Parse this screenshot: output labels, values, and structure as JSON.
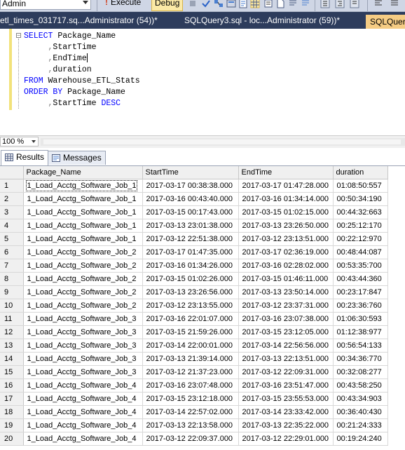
{
  "toolbar": {
    "database": "Admin",
    "execute_label": "Execute",
    "debug_label": "Debug"
  },
  "tabs": [
    {
      "label": "etl_times_031717.sq...Administrator (54))*"
    },
    {
      "label": "SQLQuery3.sql - loc...Administrator (59))*"
    },
    {
      "label": "SQLQuer"
    }
  ],
  "editor": {
    "lines": [
      [
        {
          "t": "SELECT",
          "c": "kw"
        },
        {
          "t": " Package_Name",
          "c": ""
        }
      ],
      [
        {
          "t": "     ",
          "c": ""
        },
        {
          "t": ",",
          "c": "op"
        },
        {
          "t": "StartTime",
          "c": ""
        }
      ],
      [
        {
          "t": "     ",
          "c": ""
        },
        {
          "t": ",",
          "c": "op"
        },
        {
          "t": "EndTime",
          "c": ""
        },
        {
          "t": "|",
          "c": "caret"
        }
      ],
      [
        {
          "t": "     ",
          "c": ""
        },
        {
          "t": ",",
          "c": "op"
        },
        {
          "t": "duration",
          "c": ""
        }
      ],
      [
        {
          "t": "FROM",
          "c": "kw"
        },
        {
          "t": " Warehouse_ETL_Stats",
          "c": ""
        }
      ],
      [
        {
          "t": "ORDER BY",
          "c": "kw"
        },
        {
          "t": " Package_Name",
          "c": ""
        }
      ],
      [
        {
          "t": "     ",
          "c": ""
        },
        {
          "t": ",",
          "c": "op"
        },
        {
          "t": "StartTime ",
          "c": ""
        },
        {
          "t": "DESC",
          "c": "kw"
        }
      ]
    ]
  },
  "zoom": {
    "value": "100 %"
  },
  "results_tabs": [
    {
      "label": "Results",
      "icon": "grid-icon"
    },
    {
      "label": "Messages",
      "icon": "messages-icon"
    }
  ],
  "grid": {
    "columns": [
      "Package_Name",
      "StartTime",
      "EndTime",
      "duration"
    ],
    "rows": [
      [
        "1",
        "1_Load_Acctg_Software_Job_1",
        "2017-03-17 00:38:38.000",
        "2017-03-17 01:47:28.000",
        "01:08:50:557"
      ],
      [
        "2",
        "1_Load_Acctg_Software_Job_1",
        "2017-03-16 00:43:40.000",
        "2017-03-16 01:34:14.000",
        "00:50:34:190"
      ],
      [
        "3",
        "1_Load_Acctg_Software_Job_1",
        "2017-03-15 00:17:43.000",
        "2017-03-15 01:02:15.000",
        "00:44:32:663"
      ],
      [
        "4",
        "1_Load_Acctg_Software_Job_1",
        "2017-03-13 23:01:38.000",
        "2017-03-13 23:26:50.000",
        "00:25:12:170"
      ],
      [
        "5",
        "1_Load_Acctg_Software_Job_1",
        "2017-03-12 22:51:38.000",
        "2017-03-12 23:13:51.000",
        "00:22:12:970"
      ],
      [
        "6",
        "1_Load_Acctg_Software_Job_2",
        "2017-03-17 01:47:35.000",
        "2017-03-17 02:36:19.000",
        "00:48:44:087"
      ],
      [
        "7",
        "1_Load_Acctg_Software_Job_2",
        "2017-03-16 01:34:26.000",
        "2017-03-16 02:28:02.000",
        "00:53:35:700"
      ],
      [
        "8",
        "1_Load_Acctg_Software_Job_2",
        "2017-03-15 01:02:26.000",
        "2017-03-15 01:46:11.000",
        "00:43:44:360"
      ],
      [
        "9",
        "1_Load_Acctg_Software_Job_2",
        "2017-03-13 23:26:56.000",
        "2017-03-13 23:50:14.000",
        "00:23:17:847"
      ],
      [
        "10",
        "1_Load_Acctg_Software_Job_2",
        "2017-03-12 23:13:55.000",
        "2017-03-12 23:37:31.000",
        "00:23:36:760"
      ],
      [
        "11",
        "1_Load_Acctg_Software_Job_3",
        "2017-03-16 22:01:07.000",
        "2017-03-16 23:07:38.000",
        "01:06:30:593"
      ],
      [
        "12",
        "1_Load_Acctg_Software_Job_3",
        "2017-03-15 21:59:26.000",
        "2017-03-15 23:12:05.000",
        "01:12:38:977"
      ],
      [
        "13",
        "1_Load_Acctg_Software_Job_3",
        "2017-03-14 22:00:01.000",
        "2017-03-14 22:56:56.000",
        "00:56:54:133"
      ],
      [
        "14",
        "1_Load_Acctg_Software_Job_3",
        "2017-03-13 21:39:14.000",
        "2017-03-13 22:13:51.000",
        "00:34:36:770"
      ],
      [
        "15",
        "1_Load_Acctg_Software_Job_3",
        "2017-03-12 21:37:23.000",
        "2017-03-12 22:09:31.000",
        "00:32:08:277"
      ],
      [
        "16",
        "1_Load_Acctg_Software_Job_4",
        "2017-03-16 23:07:48.000",
        "2017-03-16 23:51:47.000",
        "00:43:58:250"
      ],
      [
        "17",
        "1_Load_Acctg_Software_Job_4",
        "2017-03-15 23:12:18.000",
        "2017-03-15 23:55:53.000",
        "00:43:34:903"
      ],
      [
        "18",
        "1_Load_Acctg_Software_Job_4",
        "2017-03-14 22:57:02.000",
        "2017-03-14 23:33:42.000",
        "00:36:40:430"
      ],
      [
        "19",
        "1_Load_Acctg_Software_Job_4",
        "2017-03-13 22:13:58.000",
        "2017-03-13 22:35:22.000",
        "00:21:24:333"
      ],
      [
        "20",
        "1_Load_Acctg_Software_Job_4",
        "2017-03-12 22:09:37.000",
        "2017-03-12 22:29:01.000",
        "00:19:24:240"
      ]
    ]
  },
  "colors": {
    "tab_bar": "#2d3c5c",
    "active_tab": "#f5cc84",
    "keyword": "#0000ff",
    "operator": "#808080",
    "changed_lines": "#f2e27a"
  }
}
